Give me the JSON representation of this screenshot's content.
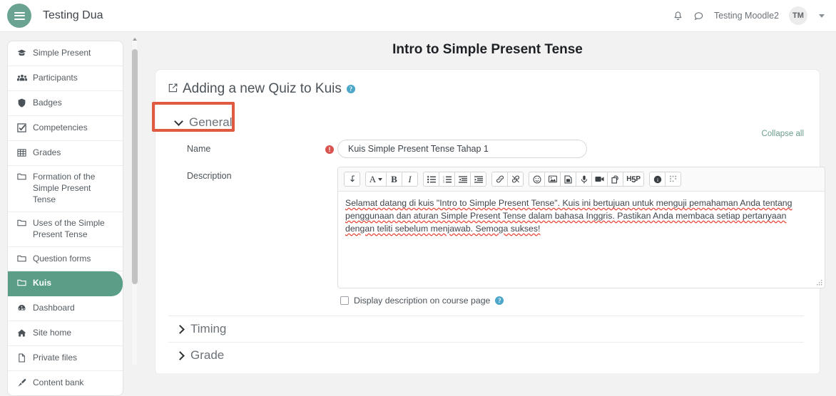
{
  "navbar": {
    "menu_icon": "hamburger-icon",
    "site_title": "Testing Dua",
    "notifications_icon": "bell-icon",
    "messages_icon": "chat-bubble-icon",
    "user_name": "Testing Moodle2",
    "avatar_initials": "TM",
    "user_menu_icon": "chevron-down-icon"
  },
  "sidebar": {
    "items": [
      {
        "label": "Simple Present",
        "icon": "graduation-cap-icon",
        "active": false
      },
      {
        "label": "Participants",
        "icon": "people-group-icon",
        "active": false
      },
      {
        "label": "Badges",
        "icon": "shield-icon",
        "active": false
      },
      {
        "label": "Competencies",
        "icon": "checkbox-checked-icon",
        "active": false
      },
      {
        "label": "Grades",
        "icon": "table-grid-icon",
        "active": false
      },
      {
        "label": "Formation of the Simple Present Tense",
        "icon": "folder-icon",
        "active": false
      },
      {
        "label": "Uses of the Simple Present Tense",
        "icon": "folder-icon",
        "active": false
      },
      {
        "label": "Question forms",
        "icon": "folder-icon",
        "active": false
      },
      {
        "label": "Kuis",
        "icon": "folder-icon",
        "active": true
      },
      {
        "label": "Dashboard",
        "icon": "dashboard-icon",
        "active": false
      },
      {
        "label": "Site home",
        "icon": "home-icon",
        "active": false
      },
      {
        "label": "Private files",
        "icon": "file-icon",
        "active": false
      },
      {
        "label": "Content bank",
        "icon": "paint-brush-icon",
        "active": false
      }
    ]
  },
  "main": {
    "page_title": "Intro to Simple Present Tense",
    "form_heading": "Adding a new Quiz to Kuis",
    "form_heading_icon": "edit-square-icon",
    "form_heading_help": "help-circle-icon",
    "collapse_all": "Collapse all",
    "sections": [
      {
        "label": "General",
        "expanded": true
      },
      {
        "label": "Timing",
        "expanded": false
      },
      {
        "label": "Grade",
        "expanded": false
      }
    ],
    "general": {
      "name_label": "Name",
      "name_required_icon": "required-exclamation-icon",
      "name_value": "Kuis Simple Present Tense Tahap 1",
      "description_label": "Description",
      "description_text": "Selamat datang di kuis \"Intro to Simple Present Tense\". Kuis ini bertujuan untuk menguji pemahaman Anda tentang penggunaan dan aturan Simple Present Tense dalam bahasa Inggris. Pastikan Anda membaca setiap pertanyaan dengan teliti sebelum menjawab. Semoga sukses!",
      "display_description_label": "Display description on course page",
      "display_description_checked": false,
      "display_description_help": "help-circle-icon"
    },
    "editor_toolbar": [
      {
        "name": "undo-redo-icon",
        "glyph": "↵"
      },
      {
        "name": "paragraph-style-icon",
        "glyph": "A"
      },
      {
        "name": "bold-icon",
        "glyph": "B"
      },
      {
        "name": "italic-icon",
        "glyph": "I"
      },
      {
        "name": "bullet-list-icon",
        "glyph": "list"
      },
      {
        "name": "numbered-list-icon",
        "glyph": "list-ol"
      },
      {
        "name": "outdent-icon",
        "glyph": "indent-left"
      },
      {
        "name": "indent-icon",
        "glyph": "indent-right"
      },
      {
        "name": "link-icon",
        "glyph": "link"
      },
      {
        "name": "unlink-icon",
        "glyph": "unlink"
      },
      {
        "name": "emoticon-icon",
        "glyph": "☺"
      },
      {
        "name": "insert-image-icon",
        "glyph": "image"
      },
      {
        "name": "manage-files-icon",
        "glyph": "file"
      },
      {
        "name": "record-audio-icon",
        "glyph": "microphone"
      },
      {
        "name": "record-video-icon",
        "glyph": "video"
      },
      {
        "name": "manage-embedded-files-icon",
        "glyph": "copy"
      },
      {
        "name": "h5p-icon",
        "glyph": "H5P"
      },
      {
        "name": "accessibility-checker-icon",
        "glyph": "ⓘ"
      },
      {
        "name": "screenreader-helper-icon",
        "glyph": "braille"
      }
    ],
    "resize_handle": "resize-grip-icon"
  },
  "annotation": {
    "target": "General",
    "color": "#e05a42"
  },
  "colors": {
    "brand_green": "#6aa391",
    "active_green": "#5a9e88",
    "required_red": "#d9534f",
    "help_blue": "#4ba6c9",
    "spellcheck_red": "#e8493a",
    "annotation_red": "#e05a42"
  }
}
